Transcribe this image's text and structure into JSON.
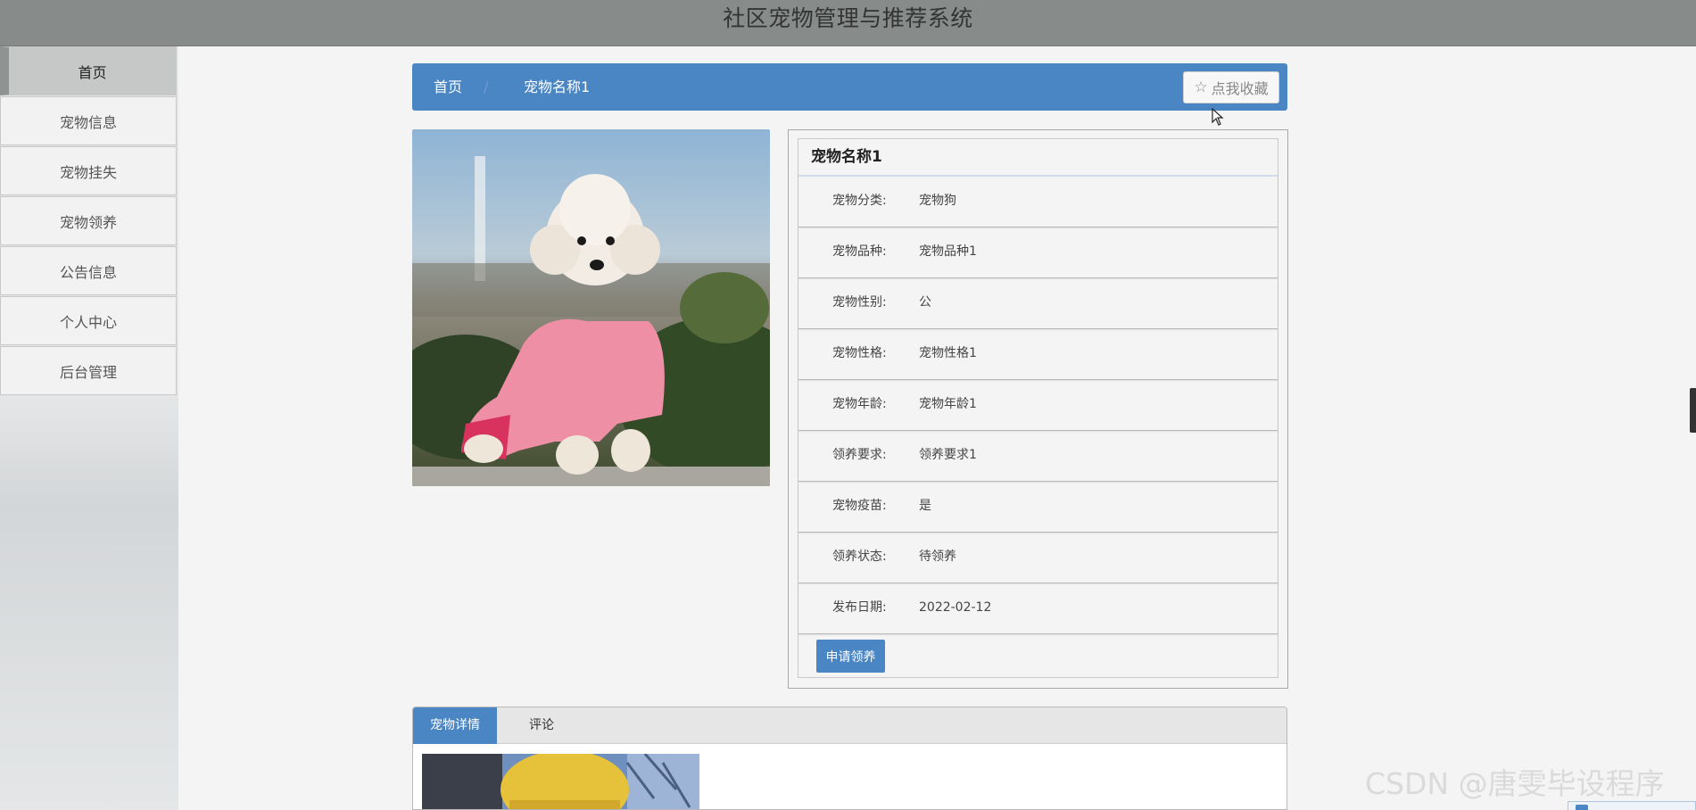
{
  "app": {
    "title": "社区宠物管理与推荐系统"
  },
  "sidebar": {
    "items": [
      {
        "label": "首页",
        "active": true
      },
      {
        "label": "宠物信息"
      },
      {
        "label": "宠物挂失"
      },
      {
        "label": "宠物领养"
      },
      {
        "label": "公告信息"
      },
      {
        "label": "个人中心"
      },
      {
        "label": "后台管理"
      }
    ]
  },
  "breadcrumb": {
    "home": "首页",
    "separator": "/",
    "current": "宠物名称1"
  },
  "favorite": {
    "label": "点我收藏",
    "icon": "star-outline-icon"
  },
  "pet": {
    "name": "宠物名称1",
    "fields": [
      {
        "label": "宠物分类:",
        "value": "宠物狗"
      },
      {
        "label": "宠物品种:",
        "value": "宠物品种1"
      },
      {
        "label": "宠物性别:",
        "value": "公"
      },
      {
        "label": "宠物性格:",
        "value": "宠物性格1"
      },
      {
        "label": "宠物年龄:",
        "value": "宠物年龄1"
      },
      {
        "label": "领养要求:",
        "value": "领养要求1"
      },
      {
        "label": "宠物疫苗:",
        "value": "是"
      },
      {
        "label": "领养状态:",
        "value": "待领养"
      },
      {
        "label": "发布日期:",
        "value": "2022-02-12"
      }
    ],
    "apply_label": "申请领养"
  },
  "tabs": [
    {
      "label": "宠物详情",
      "active": true
    },
    {
      "label": "评论"
    }
  ],
  "watermark": "CSDN @唐雯毕设程序",
  "colors": {
    "accent": "#4a85c4",
    "topbar": "#878c8b",
    "page_bg": "#f4f4f4"
  }
}
